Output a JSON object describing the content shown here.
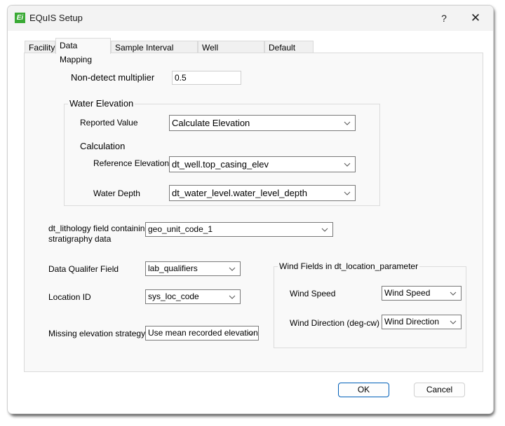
{
  "window": {
    "title": "EQuIS Setup",
    "help_label": "?",
    "close_label": "✕",
    "app_icon_glyph": "Ei"
  },
  "tabs": [
    {
      "label": "Facility",
      "active": false
    },
    {
      "label": "Data Mapping",
      "active": true
    },
    {
      "label": "Sample Interval Horizon",
      "active": false
    },
    {
      "label": "Well Construction",
      "active": false
    },
    {
      "label": "Default Units",
      "active": false
    }
  ],
  "data_mapping": {
    "non_detect": {
      "label": "Non-detect multiplier",
      "value": "0.5"
    },
    "water_elevation": {
      "group_title": "Water Elevation",
      "reported_value": {
        "label": "Reported Value",
        "value": "Calculate Elevation"
      },
      "calculation_title": "Calculation",
      "reference_elevation": {
        "label": "Reference Elevation",
        "value": "dt_well.top_casing_elev"
      },
      "water_depth": {
        "label": "Water Depth",
        "value": "dt_water_level.water_level_depth"
      }
    },
    "lithology": {
      "label_line1": "dt_lithology field containing",
      "label_line2": "stratigraphy data",
      "value": "geo_unit_code_1"
    },
    "data_qualifier": {
      "label": "Data Qualifer Field",
      "value": "lab_qualifiers"
    },
    "location_id": {
      "label": "Location ID",
      "value": "sys_loc_code"
    },
    "missing_elevation": {
      "label": "Missing elevation strategy",
      "value": "Use mean recorded elevation"
    },
    "wind": {
      "group_title": "Wind Fields in dt_location_parameter",
      "speed": {
        "label": "Wind Speed",
        "value": "Wind Speed"
      },
      "direction": {
        "label": "Wind Direction (deg-cw)",
        "value": "Wind Direction"
      }
    }
  },
  "buttons": {
    "ok": "OK",
    "cancel": "Cancel"
  },
  "colors": {
    "accent": "#005fb8",
    "app_icon": "#3aaa35"
  }
}
